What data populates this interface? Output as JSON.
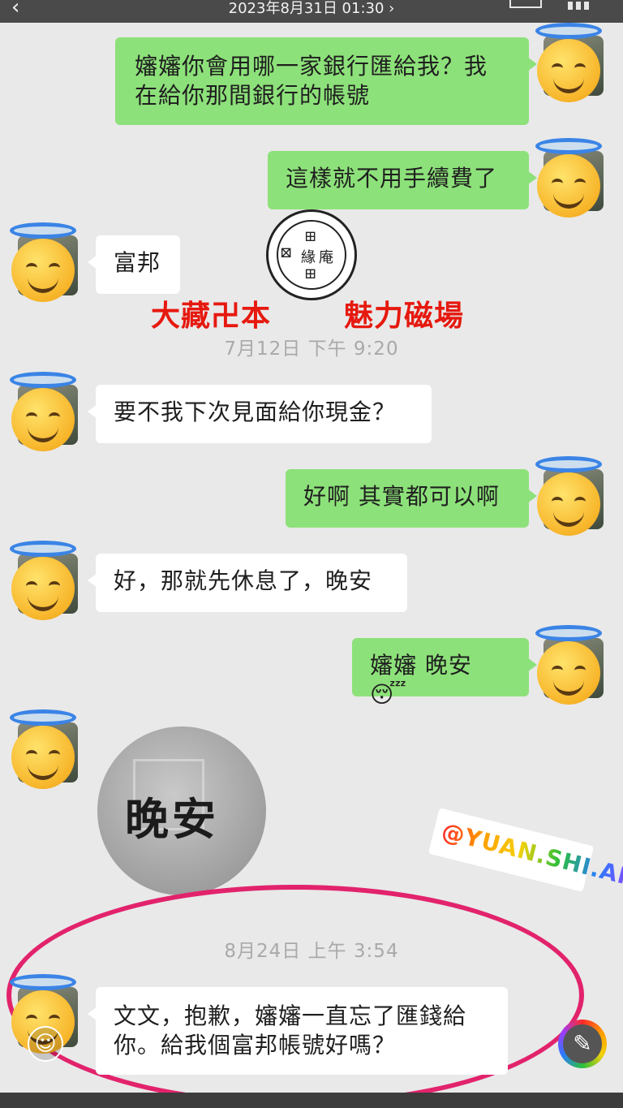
{
  "header": {
    "back_icon": "‹",
    "timestamp": "2023年8月31日 01:30 ›"
  },
  "messages": [
    {
      "side": "out",
      "text": "嬸嬸你會用哪一家銀行匯給我？我\n在給你那間銀行的帳號"
    },
    {
      "side": "out",
      "text": "這樣就不用手續費了"
    },
    {
      "side": "in",
      "text": "富邦"
    },
    {
      "side": "in",
      "text": "要不我下次見面給你現金？"
    },
    {
      "side": "out",
      "text": "好啊 其實都可以啊"
    },
    {
      "side": "in",
      "text": "好，那就先休息了，晚安"
    },
    {
      "side": "out",
      "text": "嬸嬸 晚安",
      "emoji": "😴"
    },
    {
      "side": "in",
      "sticker_text": "晚安"
    },
    {
      "side": "in",
      "text": "文文，抱歉，嬸嬸一直忘了匯錢給\n你。給我個富邦帳號好嗎？"
    }
  ],
  "timestamps": [
    "7月12日 下午 9:20",
    "8月24日 上午 3:54"
  ],
  "overlay": {
    "promo_left": "大藏卍本",
    "promo_right": "魅力磁場",
    "watermark": "@YUAN.SHI.AN",
    "seal_glyphs": [
      "緣",
      "卍",
      "庵",
      "卐"
    ]
  },
  "icons": {
    "smiley": "☺",
    "edit": "✎"
  },
  "colors": {
    "outgoing_bubble": "#8de17a",
    "incoming_bubble": "#ffffff",
    "ring": "#e2236c",
    "promo": "#e6190f"
  }
}
